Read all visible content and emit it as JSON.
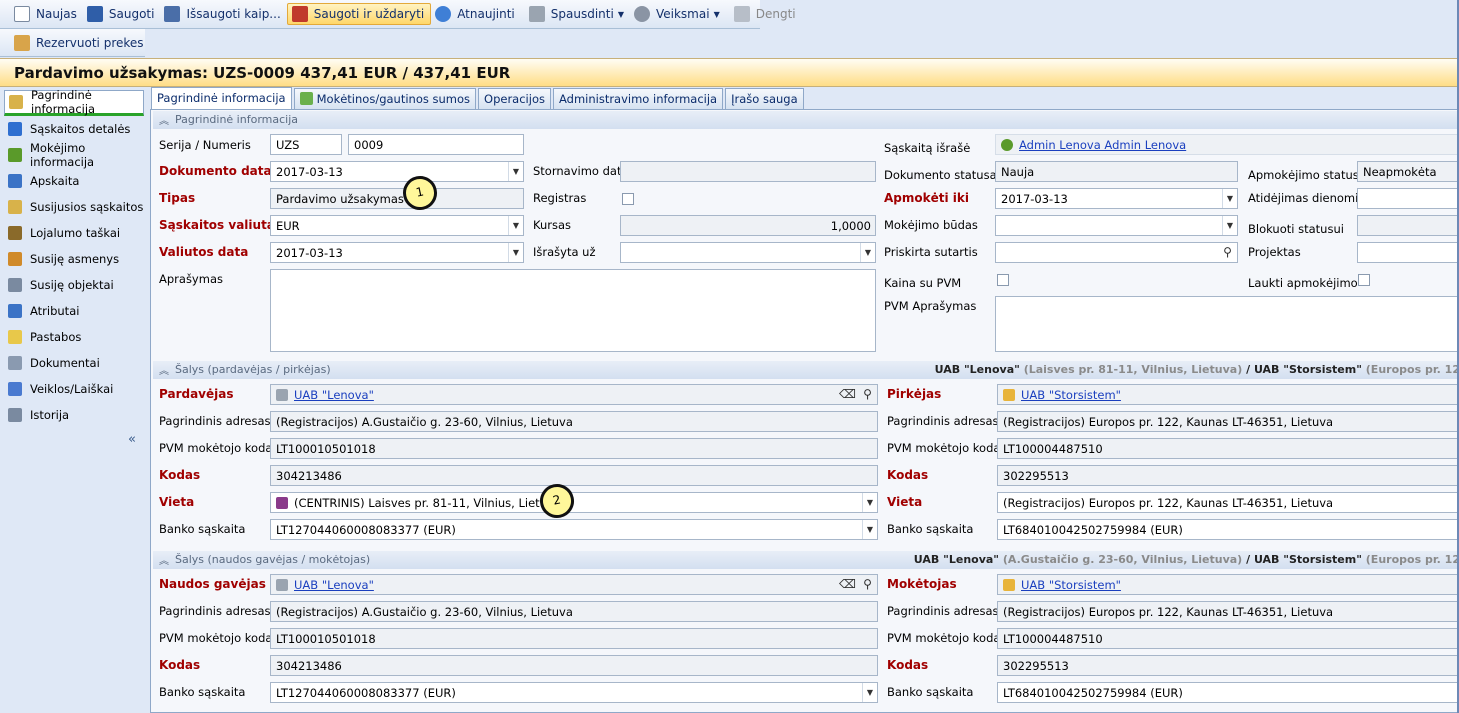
{
  "toolbar": {
    "new": "Naujas",
    "save": "Saugoti",
    "save_as": "Išsaugoti kaip...",
    "save_close": "Saugoti ir uždaryti",
    "refresh": "Atnaujinti",
    "print": "Spausdinti",
    "actions": "Veiksmai",
    "cover": "Dengti",
    "reserve": "Rezervuoti prekes"
  },
  "title": "Pardavimo užsakymas: UZS-0009 437,41 EUR / 437,41 EUR",
  "sidebar": {
    "items": [
      {
        "label": "Pagrindinė informacija",
        "icon": "doc-icon",
        "color": "#d8b24a"
      },
      {
        "label": "Sąskaitos detalės",
        "icon": "cube-icon",
        "color": "#2f6fd0"
      },
      {
        "label": "Mokėjimo informacija",
        "icon": "payment-icon",
        "color": "#5a9a2a"
      },
      {
        "label": "Apskaita",
        "icon": "ledger-icon",
        "color": "#3b73c6"
      },
      {
        "label": "Susijusios sąskaitos",
        "icon": "invoice-icon",
        "color": "#d8b24a"
      },
      {
        "label": "Lojalumo taškai",
        "icon": "loyalty-icon",
        "color": "#8a6a2a"
      },
      {
        "label": "Susiję asmenys",
        "icon": "person-icon",
        "color": "#d08a2a"
      },
      {
        "label": "Susiję objektai",
        "icon": "object-icon",
        "color": "#7a8aa0"
      },
      {
        "label": "Atributai",
        "icon": "attributes-icon",
        "color": "#3b73c6"
      },
      {
        "label": "Pastabos",
        "icon": "note-icon",
        "color": "#e8c84a"
      },
      {
        "label": "Dokumentai",
        "icon": "document-icon",
        "color": "#8a9ab0"
      },
      {
        "label": "Veiklos/Laiškai",
        "icon": "activity-icon",
        "color": "#4a7ad0"
      },
      {
        "label": "Istorija",
        "icon": "history-icon",
        "color": "#7a8aa0"
      }
    ],
    "collapse": "«"
  },
  "tabs": [
    "Pagrindinė informacija",
    "Mokėtinos/gautinos sumos",
    "Operacijos",
    "Administravimo informacija",
    "Įrašo sauga"
  ],
  "general": {
    "header": "Pagrindinė informacija",
    "series_label": "Serija / Numeris",
    "series": "UZS",
    "number": "0009",
    "doc_date_label": "Dokumento data",
    "doc_date": "2017-03-13",
    "storno_label": "Stornavimo data",
    "type_label": "Tipas",
    "type": "Pardavimo užsakymas",
    "register_label": "Registras",
    "currency_label": "Sąskaitos valiuta",
    "currency": "EUR",
    "rate_label": "Kursas",
    "rate": "1,0000",
    "currency_date_label": "Valiutos data",
    "currency_date": "2017-03-13",
    "written_for_label": "Išrašyta už",
    "description_label": "Aprašymas",
    "issued_by_label": "Sąskaitą išrašė",
    "issued_by": "Admin Lenova Admin Lenova",
    "doc_status_label": "Dokumento statusas",
    "doc_status": "Nauja",
    "pay_status_label": "Apmokėjimo statusas",
    "pay_status": "Neapmokėta",
    "pay_until_label": "Apmokėti iki",
    "pay_until": "2017-03-13",
    "delay_label": "Atidėjimas dienomis",
    "pay_method_label": "Mokėjimo būdas",
    "blocked_label": "Blokuoti statusui",
    "contract_label": "Priskirta sutartis",
    "project_label": "Projektas",
    "price_vat_label": "Kaina su PVM",
    "await_payment_label": "Laukti apmokėjimo",
    "vat_desc_label": "PVM Aprašymas",
    "bubble": "1"
  },
  "parties": {
    "header": "Šalys (pardavėjas / pirkėjas)",
    "summary_name1": "UAB \"Lenova\"",
    "summary_addr1": "(Laisves pr. 81-11, Vilnius, Lietuva)",
    "summary_sep": "/",
    "summary_name2": "UAB \"Storsistem\"",
    "summary_addr2": "(Europos pr. 12",
    "seller_label": "Pardavėjas",
    "seller": "UAB \"Lenova\"",
    "buyer_label": "Pirkėjas",
    "buyer": "UAB \"Storsistem\"",
    "main_addr_label": "Pagrindinis adresas",
    "seller_addr": "(Registracijos) A.Gustaičio g. 23-60, Vilnius, Lietuva",
    "buyer_addr": "(Registracijos) Europos pr. 122, Kaunas LT-46351, Lietuva",
    "vat_code_label": "PVM mokėtojo kodas",
    "seller_vat": "LT100010501018",
    "buyer_vat": "LT100004487510",
    "code_label": "Kodas",
    "seller_code": "304213486",
    "buyer_code": "302295513",
    "place_label": "Vieta",
    "seller_place": "(CENTRINIS) Laisves pr. 81-11, Vilnius, Lietuva",
    "buyer_place": "(Registracijos) Europos pr. 122, Kaunas LT-46351, Lietuva",
    "bank_label": "Banko sąskaita",
    "seller_bank": "LT127044060008083377 (EUR)",
    "buyer_bank": "LT684010042502759984 (EUR)",
    "bubble": "2"
  },
  "payers": {
    "header": "Šalys (naudos gavėjas / mokėtojas)",
    "summary_name1": "UAB \"Lenova\"",
    "summary_addr1": "(A.Gustaičio g. 23-60, Vilnius, Lietuva)",
    "summary_sep": "/",
    "summary_name2": "UAB \"Storsistem\"",
    "summary_addr2": "(Europos pr. 12",
    "beneficiary_label": "Naudos gavėjas",
    "beneficiary": "UAB \"Lenova\"",
    "payer_label": "Mokėtojas",
    "payer": "UAB \"Storsistem\"",
    "main_addr_label": "Pagrindinis adresas",
    "beneficiary_addr": "(Registracijos) A.Gustaičio g. 23-60, Vilnius, Lietuva",
    "payer_addr": "(Registracijos) Europos pr. 122, Kaunas LT-46351, Lietuva",
    "vat_code_label": "PVM mokėtojo kodas",
    "beneficiary_vat": "LT100010501018",
    "payer_vat": "LT100004487510",
    "code_label": "Kodas",
    "beneficiary_code": "304213486",
    "payer_code": "302295513",
    "bank_label": "Banko sąskaita",
    "beneficiary_bank": "LT127044060008083377 (EUR)",
    "payer_bank": "LT684010042502759984 (EUR)"
  }
}
